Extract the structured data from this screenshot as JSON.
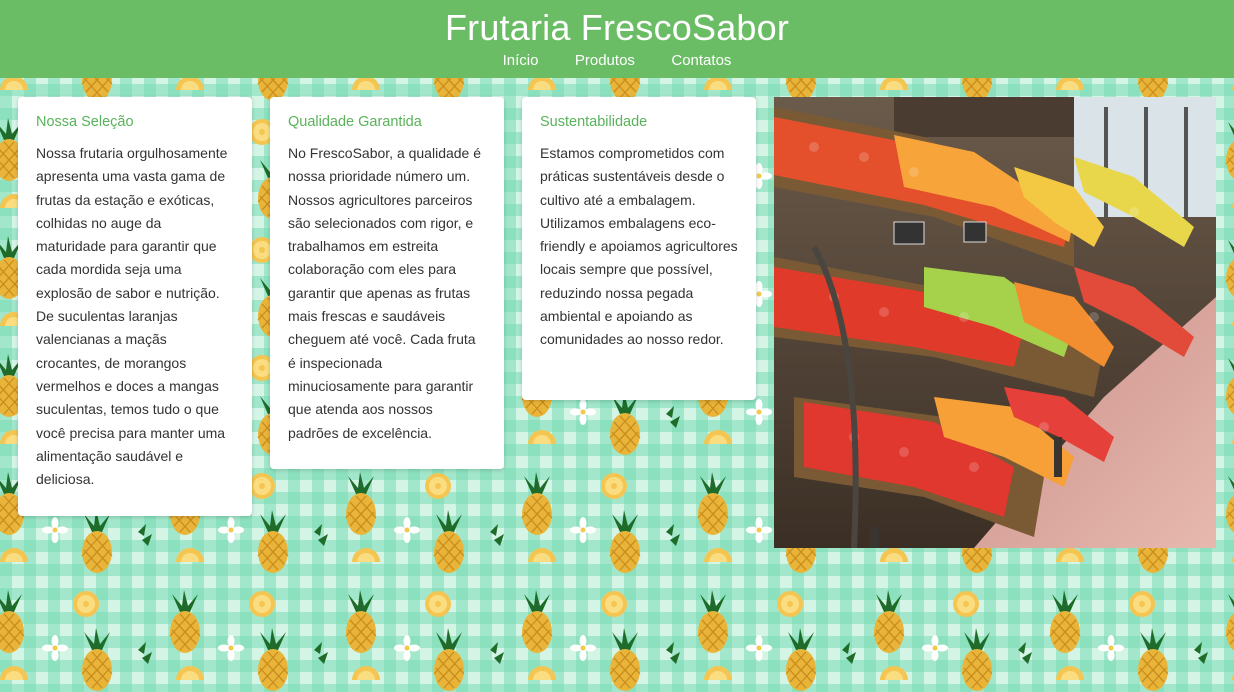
{
  "site": {
    "title": "Frutaria FrescoSabor"
  },
  "nav": {
    "items": [
      "Início",
      "Produtos",
      "Contatos"
    ]
  },
  "colors": {
    "header": "#6abd64",
    "card_title": "#59b35a",
    "text": "#333333",
    "background_gingham": "#7fe0b8"
  },
  "cards": [
    {
      "title": "Nossa Seleção",
      "text": "Nossa frutaria orgulhosamente apresenta uma vasta gama de frutas da estação e exóticas, colhidas no auge da maturidade para garantir que cada mordida seja uma explosão de sabor e nutrição. De suculentas laranjas valencianas a maçãs crocantes, de morangos vermelhos e doces a mangas suculentas, temos tudo o que você precisa para manter uma alimentação saudável e deliciosa."
    },
    {
      "title": "Qualidade Garantida",
      "text": "No FrescoSabor, a qualidade é nossa prioridade número um. Nossos agricultores parceiros são selecionados com rigor, e trabalhamos em estreita colaboração com eles para garantir que apenas as frutas mais frescas e saudáveis cheguem até você. Cada fruta é inspecionada minuciosamente para garantir que atenda aos nossos padrões de excelência."
    },
    {
      "title": "Sustentabilidade",
      "text": "Estamos comprometidos com práticas sustentáveis desde o cultivo até a embalagem. Utilizamos embalagens eco-friendly e apoiamos agricultores locais sempre que possível, reduzindo nossa pegada ambiental e apoiando as comunidades ao nosso redor."
    }
  ],
  "icons": {
    "background": "pineapple-pattern-icon",
    "photo": "fruit-stall-photo"
  }
}
